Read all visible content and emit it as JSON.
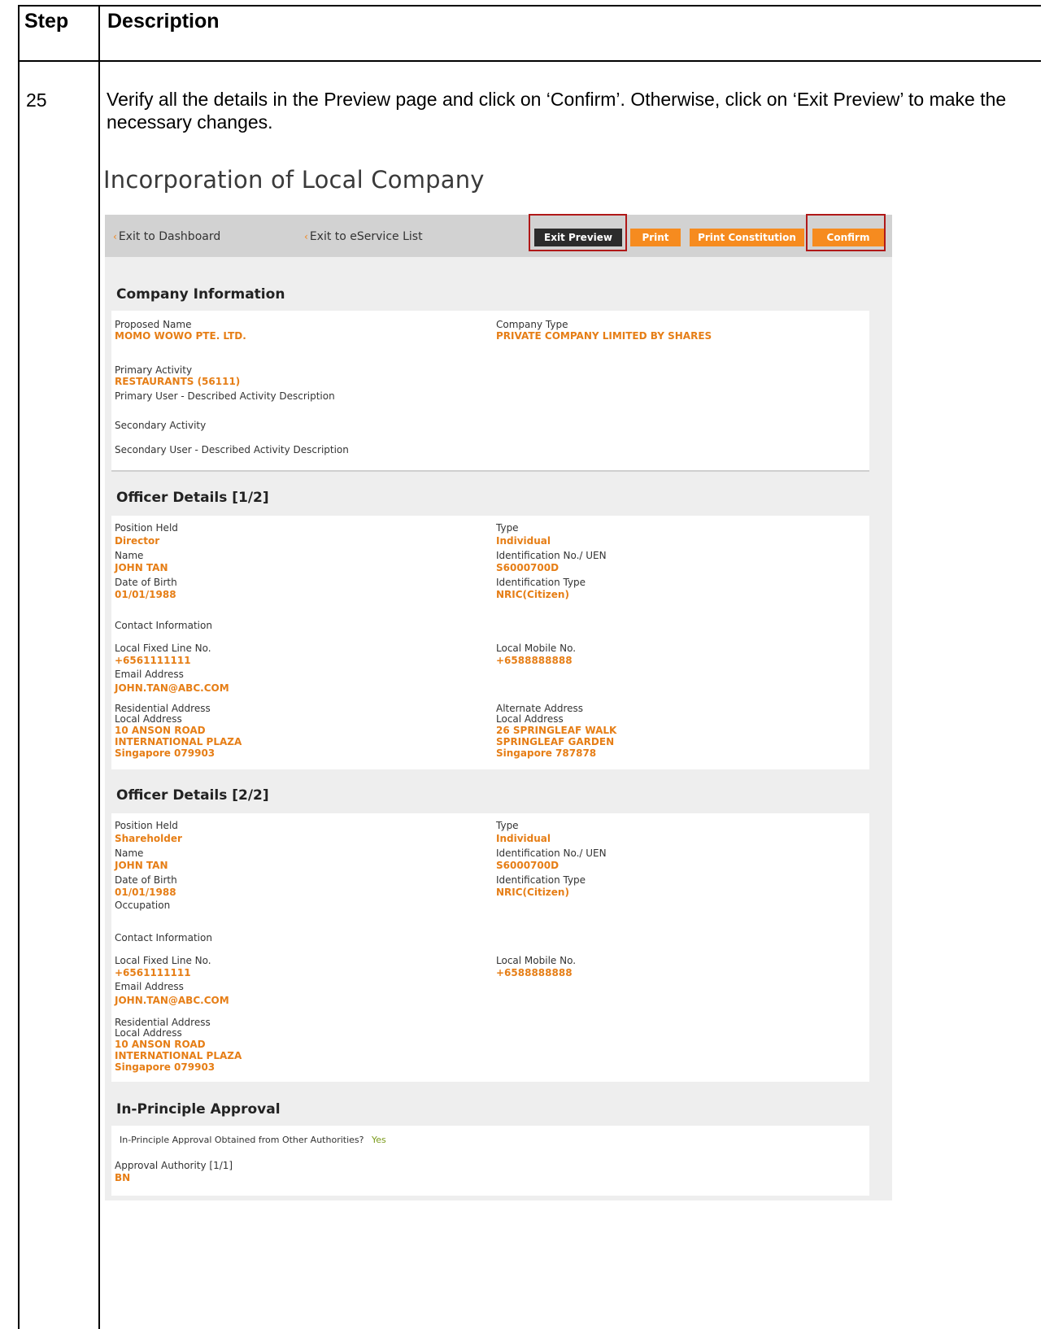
{
  "doc": {
    "header": {
      "step": "Step",
      "description": "Description"
    },
    "step_number": "25",
    "instruction": "Verify all the details in the Preview page and click on ‘Confirm’. Otherwise, click on ‘Exit Preview’ to make the necessary changes."
  },
  "page_title": "Incorporation of Local Company",
  "toolbar": {
    "exit_dashboard": "Exit to Dashboard",
    "exit_eservice": "Exit to eService List",
    "exit_preview": "Exit Preview",
    "print": "Print",
    "print_constitution": "Print Constitution",
    "confirm": "Confirm"
  },
  "company": {
    "title": "Company Information",
    "proposed_name_label": "Proposed Name",
    "proposed_name": "MOMO WOWO PTE. LTD.",
    "company_type_label": "Company Type",
    "company_type": "PRIVATE COMPANY LIMITED BY SHARES",
    "primary_activity_label": "Primary Activity",
    "primary_activity": "RESTAURANTS (56111)",
    "primary_user_desc_label": "Primary User - Described Activity Description",
    "secondary_activity_label": "Secondary Activity",
    "secondary_user_desc_label": "Secondary User - Described Activity Description"
  },
  "officer1": {
    "title": "Officer Details [1/2]",
    "position_label": "Position Held",
    "position": "Director",
    "name_label": "Name",
    "name": "JOHN TAN",
    "dob_label": "Date of Birth",
    "dob": "01/01/1988",
    "type_label": "Type",
    "type": "Individual",
    "id_label": "Identification No./ UEN",
    "id": "S6000700D",
    "id_type_label": "Identification Type",
    "id_type": "NRIC(Citizen)",
    "contact_label": "Contact Information",
    "fixed_label": "Local Fixed Line No.",
    "fixed": "+6561111111",
    "mobile_label": "Local Mobile No.",
    "mobile": "+6588888888",
    "email_label": "Email Address",
    "email": "JOHN.TAN@ABC.COM",
    "res_label": "Residential Address",
    "res_sub": "Local Address",
    "res_line1": "10 ANSON ROAD",
    "res_line2": "INTERNATIONAL PLAZA",
    "res_line3": "Singapore 079903",
    "alt_label": "Alternate Address",
    "alt_sub": "Local Address",
    "alt_line1": "26 SPRINGLEAF WALK",
    "alt_line2": "SPRINGLEAF GARDEN",
    "alt_line3": "Singapore 787878"
  },
  "officer2": {
    "title": "Officer Details [2/2]",
    "position_label": "Position Held",
    "position": "Shareholder",
    "name_label": "Name",
    "name": "JOHN TAN",
    "dob_label": "Date of Birth",
    "dob": "01/01/1988",
    "occupation_label": "Occupation",
    "type_label": "Type",
    "type": "Individual",
    "id_label": "Identification No./ UEN",
    "id": "S6000700D",
    "id_type_label": "Identification Type",
    "id_type": "NRIC(Citizen)",
    "contact_label": "Contact Information",
    "fixed_label": "Local Fixed Line No.",
    "fixed": "+6561111111",
    "mobile_label": "Local Mobile No.",
    "mobile": "+6588888888",
    "email_label": "Email Address",
    "email": "JOHN.TAN@ABC.COM",
    "res_label": "Residential Address",
    "res_sub": "Local Address",
    "res_line1": "10 ANSON ROAD",
    "res_line2": "INTERNATIONAL PLAZA",
    "res_line3": "Singapore 079903"
  },
  "approval": {
    "title": "In-Principle Approval",
    "question": "In-Principle Approval Obtained from Other Authorities?",
    "answer": "Yes",
    "authority_label": "Approval Authority [1/1]",
    "authority": "BN"
  }
}
